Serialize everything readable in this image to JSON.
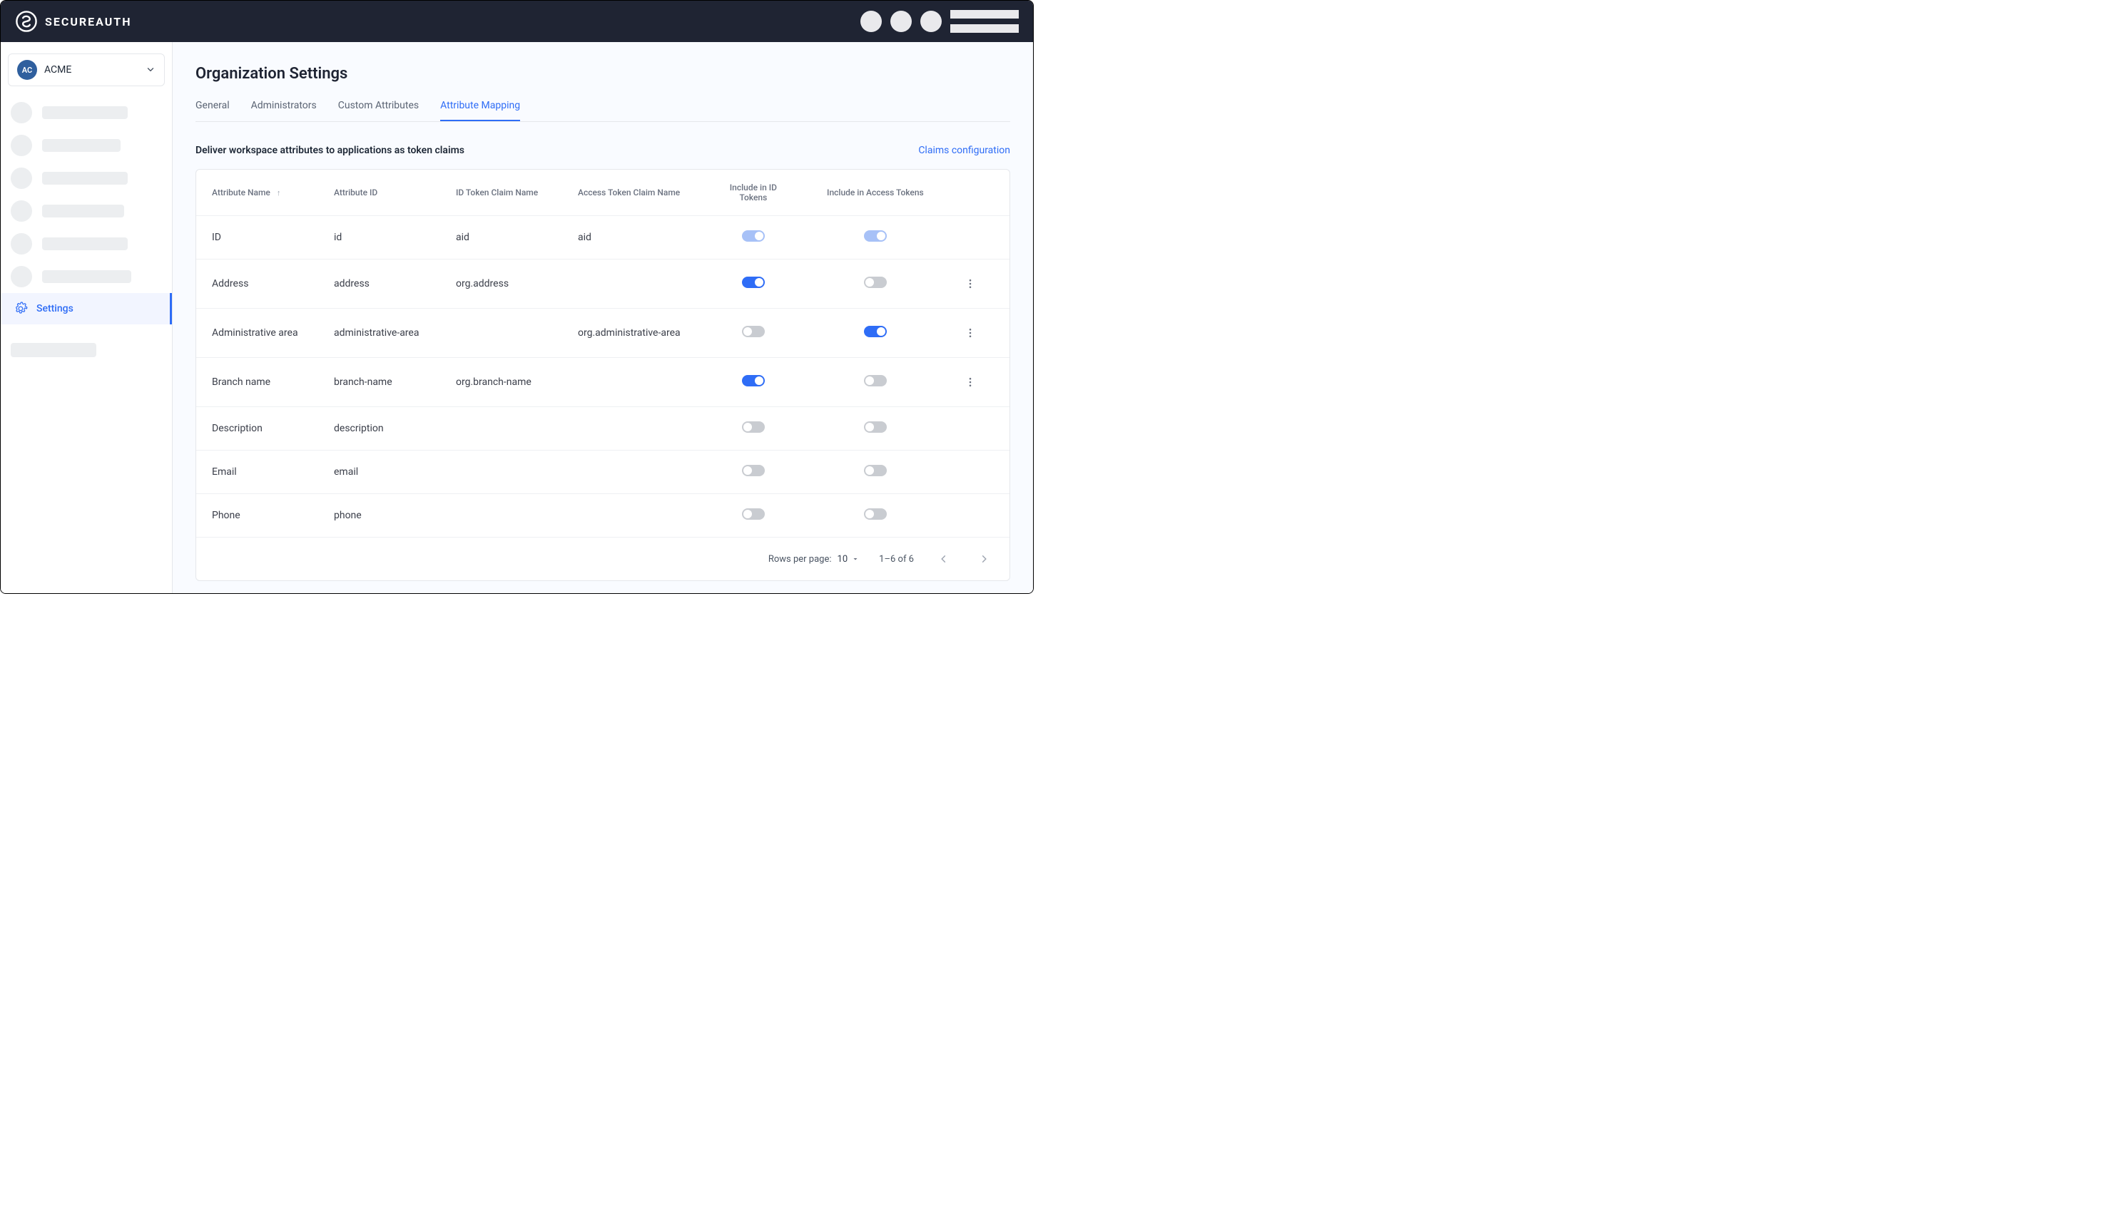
{
  "brand": {
    "name": "SECUREAUTH"
  },
  "org": {
    "avatar_initials": "AC",
    "name": "ACME"
  },
  "sidebar": {
    "settings_label": "Settings"
  },
  "page": {
    "title": "Organization Settings",
    "tabs": [
      {
        "label": "General",
        "active": false
      },
      {
        "label": "Administrators",
        "active": false
      },
      {
        "label": "Custom Attributes",
        "active": false
      },
      {
        "label": "Attribute Mapping",
        "active": true
      }
    ],
    "section_title": "Deliver workspace attributes to applications as token claims",
    "claims_link": "Claims configuration"
  },
  "table": {
    "columns": {
      "attr_name": "Attribute Name",
      "attr_id": "Attribute ID",
      "id_claim": "ID Token Claim Name",
      "access_claim": "Access Token Claim Name",
      "include_id": "Include in ID Tokens",
      "include_access": "Include in Access Tokens"
    },
    "sort_column": "attr_name",
    "sort_dir": "asc",
    "rows": [
      {
        "name": "ID",
        "id": "id",
        "id_claim": "aid",
        "access_claim": "aid",
        "include_id": "on-disabled",
        "include_access": "on-disabled",
        "has_menu": false
      },
      {
        "name": "Address",
        "id": "address",
        "id_claim": "org.address",
        "access_claim": "",
        "include_id": "on",
        "include_access": "off",
        "has_menu": true
      },
      {
        "name": "Administrative area",
        "id": "administrative-area",
        "id_claim": "",
        "access_claim": "org.administrative-area",
        "include_id": "off",
        "include_access": "on",
        "has_menu": true
      },
      {
        "name": "Branch name",
        "id": "branch-name",
        "id_claim": "org.branch-name",
        "access_claim": "",
        "include_id": "on",
        "include_access": "off",
        "has_menu": true
      },
      {
        "name": "Description",
        "id": "description",
        "id_claim": "",
        "access_claim": "",
        "include_id": "off",
        "include_access": "off",
        "has_menu": false
      },
      {
        "name": "Email",
        "id": "email",
        "id_claim": "",
        "access_claim": "",
        "include_id": "off",
        "include_access": "off",
        "has_menu": false
      },
      {
        "name": "Phone",
        "id": "phone",
        "id_claim": "",
        "access_claim": "",
        "include_id": "off",
        "include_access": "off",
        "has_menu": false
      }
    ],
    "footer": {
      "rows_per_page_label": "Rows per page:",
      "rows_per_page_value": "10",
      "range_label": "1–6 of 6"
    }
  }
}
